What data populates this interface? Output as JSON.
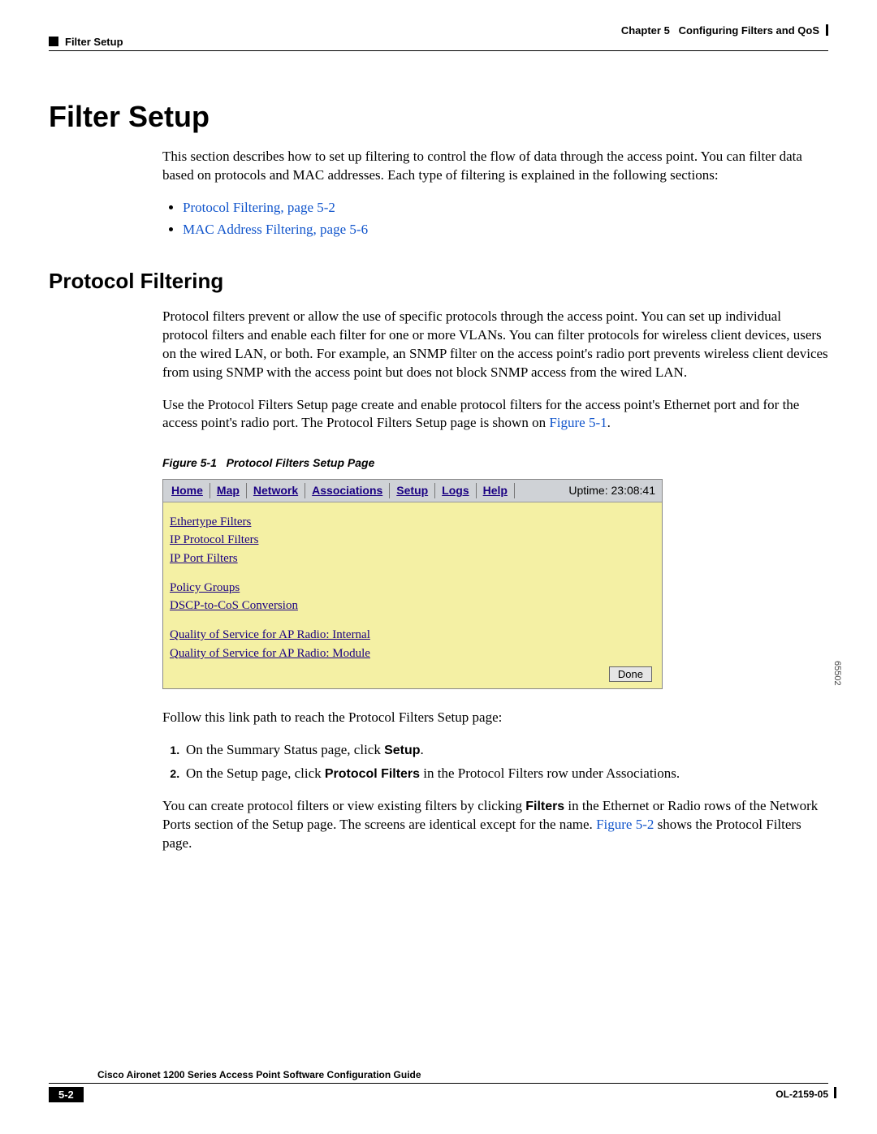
{
  "header": {
    "chapter": "Chapter 5",
    "chapter_title": "Configuring Filters and QoS",
    "section": "Filter Setup"
  },
  "title": "Filter Setup",
  "intro": "This section describes how to set up filtering to control the flow of data through the access point. You can filter data based on protocols and MAC addresses. Each type of filtering is explained in the following sections:",
  "toc": {
    "item1": "Protocol Filtering, page 5-2",
    "item2": "MAC Address Filtering, page 5-6"
  },
  "section2": {
    "heading": "Protocol Filtering",
    "para1": "Protocol filters prevent or allow the use of specific protocols through the access point. You can set up individual protocol filters and enable each filter for one or more VLANs. You can filter protocols for wireless client devices, users on the wired LAN, or both. For example, an SNMP filter on the access point's radio port prevents wireless client devices from using SNMP with the access point but does not block SNMP access from the wired LAN.",
    "para2a": "Use the Protocol Filters Setup page create and enable protocol filters for the access point's Ethernet port and for the access point's radio port. The Protocol Filters Setup page is shown on ",
    "para2link": "Figure 5-1",
    "para2b": "."
  },
  "figure": {
    "caption_num": "Figure 5-1",
    "caption_title": "Protocol Filters Setup Page",
    "side_num": "65502",
    "nav": {
      "home": "Home",
      "map": "Map",
      "network": "Network",
      "assoc": "Associations",
      "setup": "Setup",
      "logs": "Logs",
      "help": "Help"
    },
    "uptime": "Uptime: 23:08:41",
    "links": {
      "g1a": "Ethertype Filters",
      "g1b": "IP Protocol Filters",
      "g1c": "IP Port Filters",
      "g2a": "Policy Groups",
      "g2b": "DSCP-to-CoS Conversion",
      "g3a": "Quality of Service for AP Radio: Internal",
      "g3b": "Quality of Service for AP Radio: Module"
    },
    "done": "Done"
  },
  "after_fig": {
    "lead": "Follow this link path to reach the Protocol Filters Setup page:",
    "step1a": "On the Summary Status page, click ",
    "step1b": "Setup",
    "step1c": ".",
    "step2a": "On the Setup page, click ",
    "step2b": "Protocol Filters",
    "step2c": " in the Protocol Filters row under Associations.",
    "closing_a": "You can create protocol filters or view existing filters by clicking ",
    "closing_b": "Filters",
    "closing_c": " in the Ethernet or Radio rows of the Network Ports section of the Setup page. The screens are identical except for the name. ",
    "closing_link": "Figure 5-2",
    "closing_d": " shows the Protocol Filters page."
  },
  "footer": {
    "guide": "Cisco Aironet 1200 Series Access Point Software Configuration Guide",
    "page": "5-2",
    "doc": "OL-2159-05"
  }
}
